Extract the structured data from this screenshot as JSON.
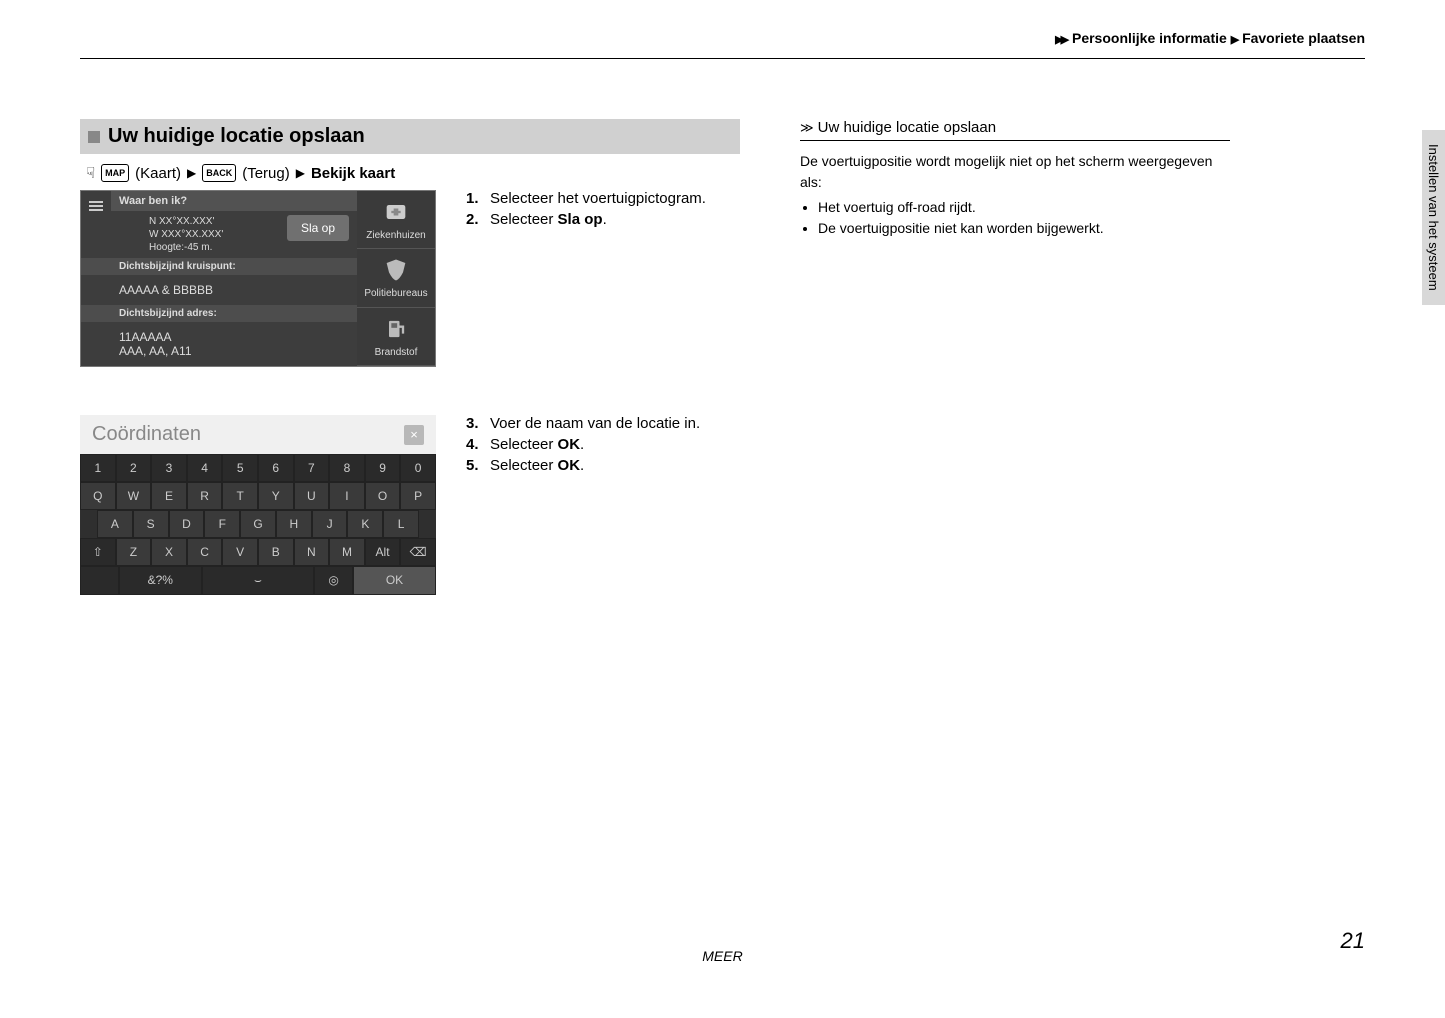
{
  "breadcrumb": {
    "seg1": "Persoonlijke informatie",
    "seg2": "Favoriete plaatsen"
  },
  "section_title": "Uw huidige locatie opslaan",
  "path": {
    "map_icon_label": "MAP",
    "map_text": "(Kaart)",
    "back_icon_label": "BACK",
    "back_text": "(Terug)",
    "final": "Bekijk kaart"
  },
  "screenshot1": {
    "header": "Waar ben ik?",
    "coord1": "N XX°XX.XXX'",
    "coord2": "W XXX°XX.XXX'",
    "altitude": "Hoogte:-45 m.",
    "save_btn": "Sla op",
    "junction_label": "Dichtsbijzijnd kruispunt:",
    "junction_value": "AAAAA & BBBBB",
    "address_label": "Dichtsbijzijnd adres:",
    "address_value1": "11AAAAA",
    "address_value2": "AAA, AA, A11",
    "poi1": "Ziekenhuizen",
    "poi2": "Politiebureaus",
    "poi3": "Brandstof"
  },
  "steps1": [
    {
      "n": "1.",
      "t": "Selecteer het voertuigpictogram."
    },
    {
      "n": "2.",
      "t_pre": "Selecteer ",
      "t_bold": "Sla op",
      "t_post": "."
    }
  ],
  "screenshot2": {
    "input_value": "Coördinaten",
    "row1": [
      "1",
      "2",
      "3",
      "4",
      "5",
      "6",
      "7",
      "8",
      "9",
      "0"
    ],
    "row2": [
      "Q",
      "W",
      "E",
      "R",
      "T",
      "Y",
      "U",
      "I",
      "O",
      "P"
    ],
    "row3": [
      "A",
      "S",
      "D",
      "F",
      "G",
      "H",
      "J",
      "K",
      "L"
    ],
    "row4_shift": "⇧",
    "row4": [
      "Z",
      "X",
      "C",
      "V",
      "B",
      "N",
      "M"
    ],
    "row4_alt": "Alt",
    "row4_bksp": "⌫",
    "row5_sym": "&?%",
    "row5_space": "⌣",
    "row5_mic": "◎",
    "row5_ok": "OK"
  },
  "steps2": [
    {
      "n": "3.",
      "t": "Voer de naam van de locatie in."
    },
    {
      "n": "4.",
      "t_pre": "Selecteer ",
      "t_bold": "OK",
      "t_post": "."
    },
    {
      "n": "5.",
      "t_pre": "Selecteer ",
      "t_bold": "OK",
      "t_post": "."
    }
  ],
  "sidebar": {
    "heading": "Uw huidige locatie opslaan",
    "intro": "De voertuigpositie wordt mogelijk niet op het scherm weergegeven als:",
    "bullets": [
      "Het voertuig off-road rijdt.",
      "De voertuigpositie niet kan worden bijgewerkt."
    ]
  },
  "side_tab": "Instellen van het systeem",
  "footer": {
    "meer": "MEER",
    "page": "21"
  }
}
